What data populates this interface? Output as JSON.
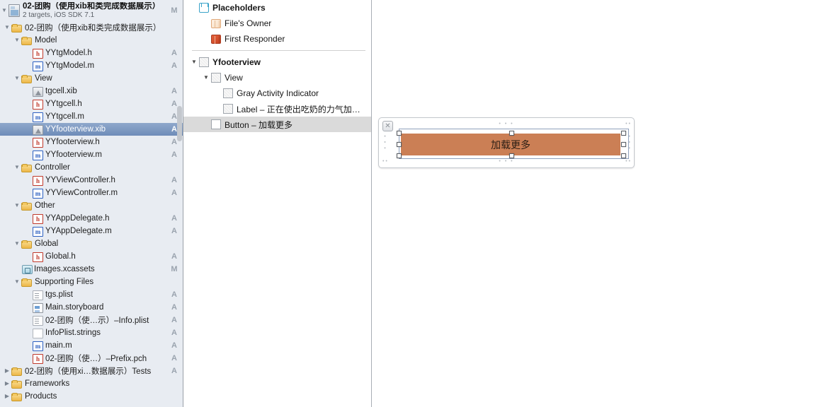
{
  "navigator": {
    "project": {
      "title": "02-团购（使用xib和类完成数据展示）",
      "subtitle": "2 targets, iOS SDK 7.1",
      "status": "M"
    },
    "rows": [
      {
        "label": "02-团购（使用xib和类完成数据展示）",
        "icon": "folder",
        "depth": 1,
        "disc": "open",
        "status": ""
      },
      {
        "label": "Model",
        "icon": "folder",
        "depth": 2,
        "disc": "open",
        "status": ""
      },
      {
        "label": "YYtgModel.h",
        "icon": "h",
        "depth": 3,
        "disc": "none",
        "status": "A"
      },
      {
        "label": "YYtgModel.m",
        "icon": "m",
        "depth": 3,
        "disc": "none",
        "status": "A"
      },
      {
        "label": "View",
        "icon": "folder",
        "depth": 2,
        "disc": "open",
        "status": ""
      },
      {
        "label": "tgcell.xib",
        "icon": "xib",
        "depth": 3,
        "disc": "none",
        "status": "A"
      },
      {
        "label": "YYtgcell.h",
        "icon": "h",
        "depth": 3,
        "disc": "none",
        "status": "A"
      },
      {
        "label": "YYtgcell.m",
        "icon": "m",
        "depth": 3,
        "disc": "none",
        "status": "A"
      },
      {
        "label": "YYfooterview.xib",
        "icon": "xib",
        "depth": 3,
        "disc": "none",
        "status": "A",
        "selected": true
      },
      {
        "label": "YYfooterview.h",
        "icon": "h",
        "depth": 3,
        "disc": "none",
        "status": "A"
      },
      {
        "label": "YYfooterview.m",
        "icon": "m",
        "depth": 3,
        "disc": "none",
        "status": "A"
      },
      {
        "label": "Controller",
        "icon": "folder",
        "depth": 2,
        "disc": "open",
        "status": ""
      },
      {
        "label": "YYViewController.h",
        "icon": "h",
        "depth": 3,
        "disc": "none",
        "status": "A"
      },
      {
        "label": "YYViewController.m",
        "icon": "m",
        "depth": 3,
        "disc": "none",
        "status": "A"
      },
      {
        "label": "Other",
        "icon": "folder",
        "depth": 2,
        "disc": "open",
        "status": ""
      },
      {
        "label": "YYAppDelegate.h",
        "icon": "h",
        "depth": 3,
        "disc": "none",
        "status": "A"
      },
      {
        "label": "YYAppDelegate.m",
        "icon": "m",
        "depth": 3,
        "disc": "none",
        "status": "A"
      },
      {
        "label": "Global",
        "icon": "folder",
        "depth": 2,
        "disc": "open",
        "status": ""
      },
      {
        "label": "Global.h",
        "icon": "h",
        "depth": 3,
        "disc": "none",
        "status": "A"
      },
      {
        "label": "Images.xcassets",
        "icon": "assets",
        "depth": 2,
        "disc": "none",
        "status": "M"
      },
      {
        "label": "Supporting Files",
        "icon": "folder",
        "depth": 2,
        "disc": "open",
        "status": ""
      },
      {
        "label": "tgs.plist",
        "icon": "plist",
        "depth": 3,
        "disc": "none",
        "status": "A"
      },
      {
        "label": "Main.storyboard",
        "icon": "storyboard",
        "depth": 3,
        "disc": "none",
        "status": "A"
      },
      {
        "label": "02-团购（使…示）–Info.plist",
        "icon": "plist",
        "depth": 3,
        "disc": "none",
        "status": "A"
      },
      {
        "label": "InfoPlist.strings",
        "icon": "strings",
        "depth": 3,
        "disc": "none",
        "status": "A"
      },
      {
        "label": "main.m",
        "icon": "m",
        "depth": 3,
        "disc": "none",
        "status": "A"
      },
      {
        "label": "02-团购（使…）–Prefix.pch",
        "icon": "pch",
        "depth": 3,
        "disc": "none",
        "status": "A"
      },
      {
        "label": "02-团购（使用xi…数据展示）Tests",
        "icon": "folder",
        "depth": 1,
        "disc": "closed",
        "status": "A"
      },
      {
        "label": "Frameworks",
        "icon": "folder",
        "depth": 1,
        "disc": "closed",
        "status": ""
      },
      {
        "label": "Products",
        "icon": "folder",
        "depth": 1,
        "disc": "closed",
        "status": ""
      }
    ]
  },
  "outline": {
    "rows": [
      {
        "label": "Placeholders",
        "icon": "cube-blue",
        "depth": 0,
        "disc": "none",
        "head": true
      },
      {
        "label": "File's Owner",
        "icon": "cube-lt",
        "depth": 1,
        "disc": "none"
      },
      {
        "label": "First Responder",
        "icon": "cube-red",
        "depth": 1,
        "disc": "none"
      },
      {
        "divider": true
      },
      {
        "label": "Yfooterview",
        "icon": "box-plain",
        "depth": 0,
        "disc": "open",
        "head": true
      },
      {
        "label": "View",
        "icon": "box-plain",
        "depth": 1,
        "disc": "open"
      },
      {
        "label": "Gray Activity Indicator",
        "icon": "box-plain",
        "depth": 2,
        "disc": "none"
      },
      {
        "label": "Label – 正在使出吃奶的力气加…",
        "icon": "box-plain",
        "depth": 2,
        "disc": "none"
      },
      {
        "label": "Button – 加载更多",
        "icon": "box-white",
        "depth": 1,
        "disc": "none",
        "selected": true
      }
    ]
  },
  "canvas": {
    "close_glyph": "✕",
    "button_label": "加载更多",
    "button_color": "#cb7f55",
    "guide_dots": "• • •"
  }
}
